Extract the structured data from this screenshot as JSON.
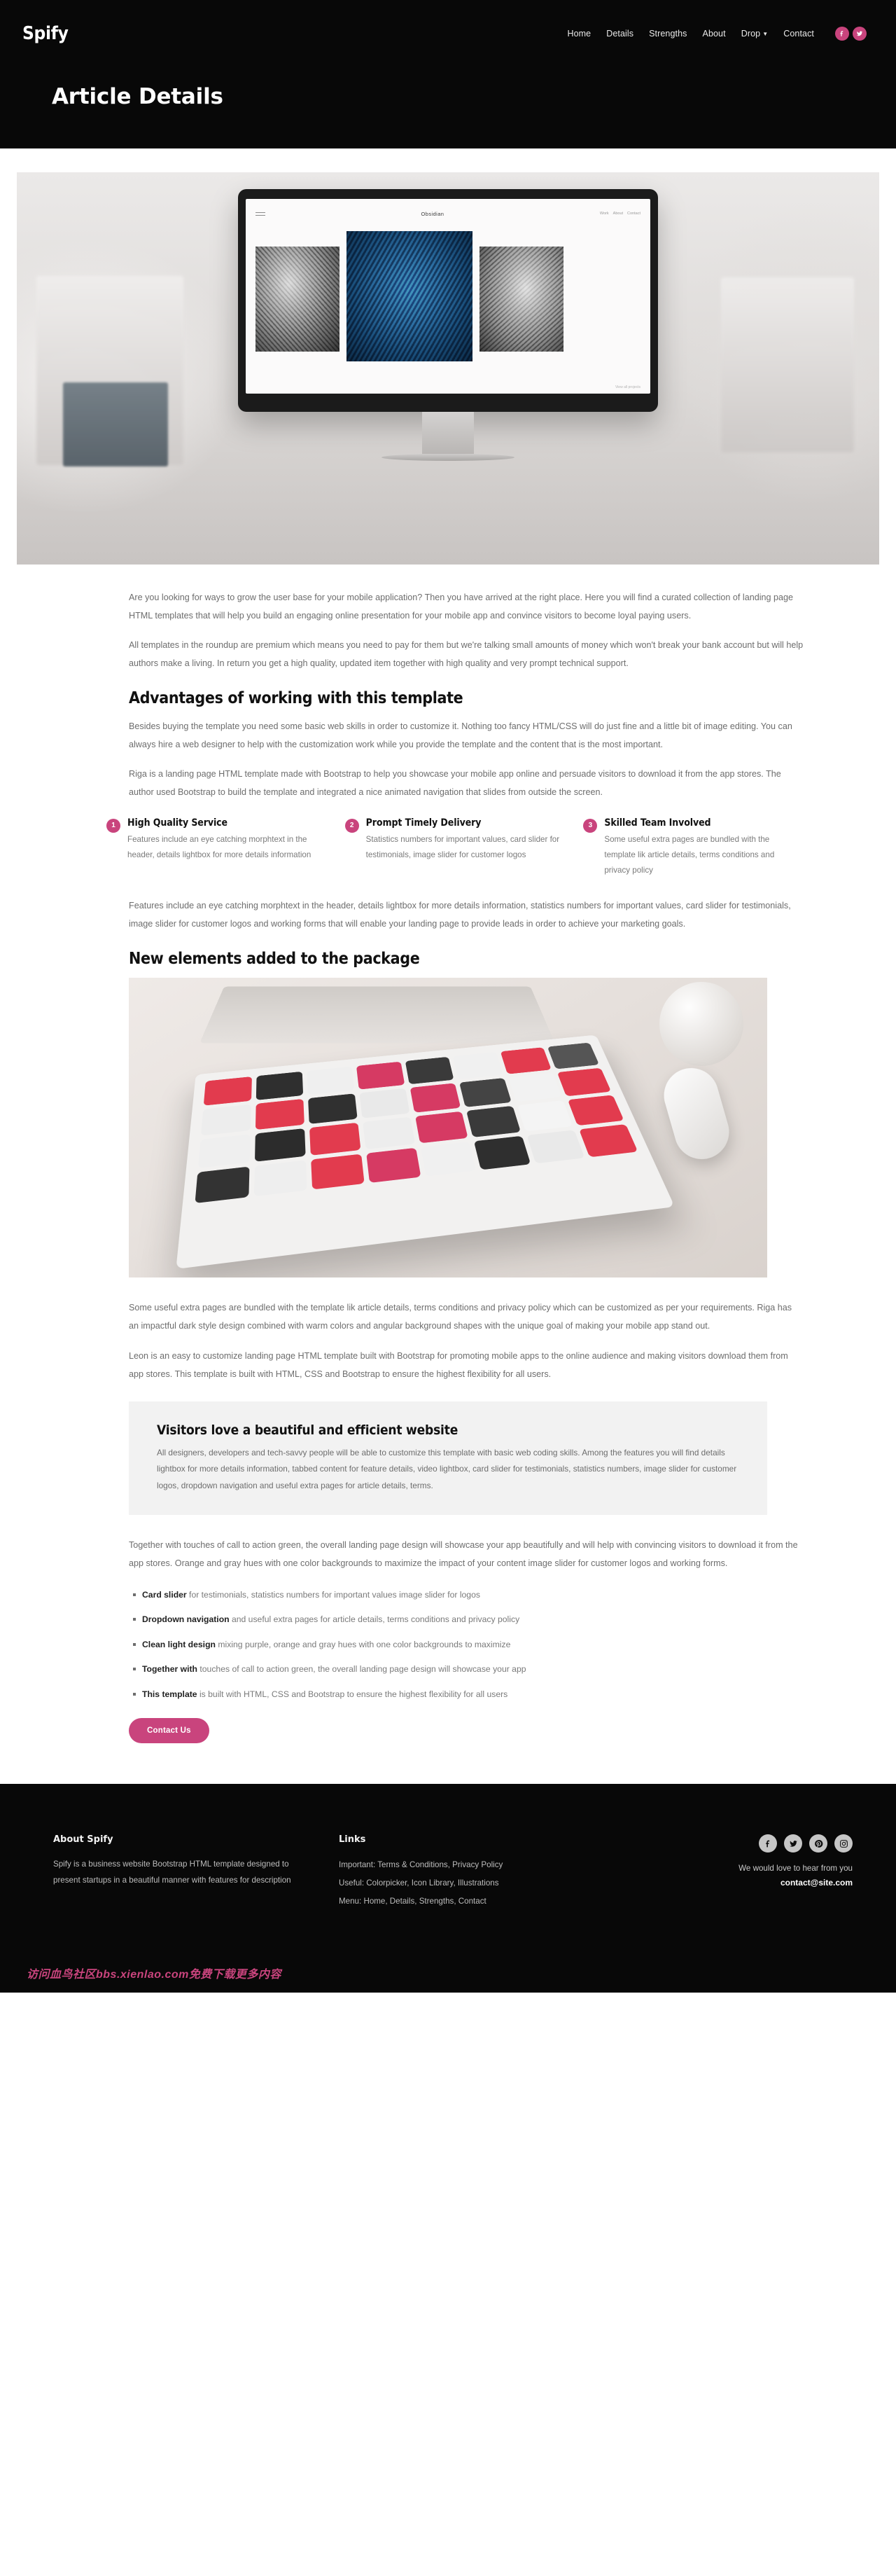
{
  "brand": "Spify",
  "nav": {
    "items": [
      {
        "label": "Home",
        "caret": false
      },
      {
        "label": "Details",
        "caret": false
      },
      {
        "label": "Strengths",
        "caret": false
      },
      {
        "label": "About",
        "caret": false
      },
      {
        "label": "Drop",
        "caret": true
      },
      {
        "label": "Contact",
        "caret": false
      }
    ],
    "social": [
      "facebook-icon",
      "twitter-icon"
    ]
  },
  "page_title": "Article Details",
  "hero": {
    "screen_title": "Obsidian",
    "screen_nav": [
      "Work",
      "About",
      "Contact"
    ],
    "screen_footer": "View all projects"
  },
  "article": {
    "intro_p1": "Are you looking for ways to grow the user base for your mobile application? Then you have arrived at the right place. Here you will find a curated collection of landing page HTML templates that will help you build an engaging online presentation for your mobile app and convince visitors to become loyal paying users.",
    "intro_p2": "All templates in the roundup are premium which means you need to pay for them but we're talking small amounts of money which won't break your bank account but will help authors make a living. In return you get a high quality, updated item together with high quality and very prompt technical support.",
    "advantages_heading": "Advantages of working with this template",
    "advantages_p1": "Besides buying the template you need some basic web skills in order to customize it. Nothing too fancy HTML/CSS will do just fine and a little bit of image editing. You can always hire a web designer to help with the customization work while you provide the template and the content that is the most important.",
    "advantages_p2": "Riga is a landing page HTML template made with Bootstrap to help you showcase your mobile app online and persuade visitors to download it from the app stores. The author used Bootstrap to build the template and integrated a nice animated navigation that slides from outside the screen.",
    "features": [
      {
        "num": "1",
        "title": "High Quality Service",
        "text": "Features include an eye catching morphtext in the header, details lightbox for more details information"
      },
      {
        "num": "2",
        "title": "Prompt Timely Delivery",
        "text": "Statistics numbers for important values, card slider for testimonials, image slider for customer logos"
      },
      {
        "num": "3",
        "title": "Skilled Team Involved",
        "text": "Some useful extra pages are bundled with the template lik article details, terms conditions and privacy policy"
      }
    ],
    "features_summary": "Features include an eye catching morphtext in the header, details lightbox for more details information, statistics numbers for important values, card slider for testimonials, image slider for customer logos and working forms that will enable your landing page to provide leads in order to achieve your marketing goals.",
    "new_elements_heading": "New elements added to the package",
    "after_img_p1": "Some useful extra pages are bundled with the template lik article details, terms conditions and privacy policy which can be customized as per your requirements. Riga has an impactful dark style design combined with warm colors and angular background shapes with the unique goal of making your mobile app stand out.",
    "after_img_p2": "Leon is an easy to customize landing page HTML template built with Bootstrap for promoting mobile apps to the online audience and making visitors download them from app stores. This template is built with HTML, CSS and Bootstrap to ensure the highest flexibility for all users.",
    "callout_heading": "Visitors love a beautiful and efficient website",
    "callout_text": "All designers, developers and tech-savvy people will be able to customize this template with basic web coding skills. Among the features you will find details lightbox for more details information, tabbed content for feature details, video lightbox, card slider for testimonials, statistics numbers, image slider for customer logos, dropdown navigation and useful extra pages for article details, terms.",
    "closing_p": "Together with touches of call to action green, the overall landing page design will showcase your app beautifully and will help with convincing visitors to download it from the app stores. Orange and gray hues with one color backgrounds to maximize the impact of your content image slider for customer logos and working forms.",
    "bullets": [
      {
        "bold": "Card slider",
        "rest": " for testimonials, statistics numbers for important values image slider for logos"
      },
      {
        "bold": "Dropdown navigation",
        "rest": " and useful extra pages for article details, terms conditions and privacy policy"
      },
      {
        "bold": "Clean light design",
        "rest": " mixing purple, orange and gray hues with one color backgrounds to maximize"
      },
      {
        "bold": "Together with",
        "rest": " touches of call to action green, the overall landing page design will showcase your app"
      },
      {
        "bold": "This template",
        "rest": " is built with HTML, CSS and Bootstrap to ensure the highest flexibility for all users"
      }
    ],
    "cta_label": "Contact Us"
  },
  "footer": {
    "about_heading": "About Spify",
    "about_text": "Spify is a business website Bootstrap HTML template designed to present startups in a beautiful manner with features for description",
    "links_heading": "Links",
    "links": [
      "Important: Terms & Conditions, Privacy Policy",
      "Useful: Colorpicker, Icon Library, Illustrations",
      "Menu: Home, Details, Strengths, Contact"
    ],
    "socials": [
      "facebook-icon",
      "twitter-icon",
      "pinterest-icon",
      "instagram-icon"
    ],
    "note": "We would love to hear from you",
    "email": "contact@site.com"
  },
  "watermark": "访问血鸟社区bbs.xienlao.com免费下载更多内容",
  "colors": {
    "accent": "#c9447d",
    "dark": "#080808",
    "body_text": "#6d6d6d",
    "callout_bg": "#f2f2f2"
  }
}
